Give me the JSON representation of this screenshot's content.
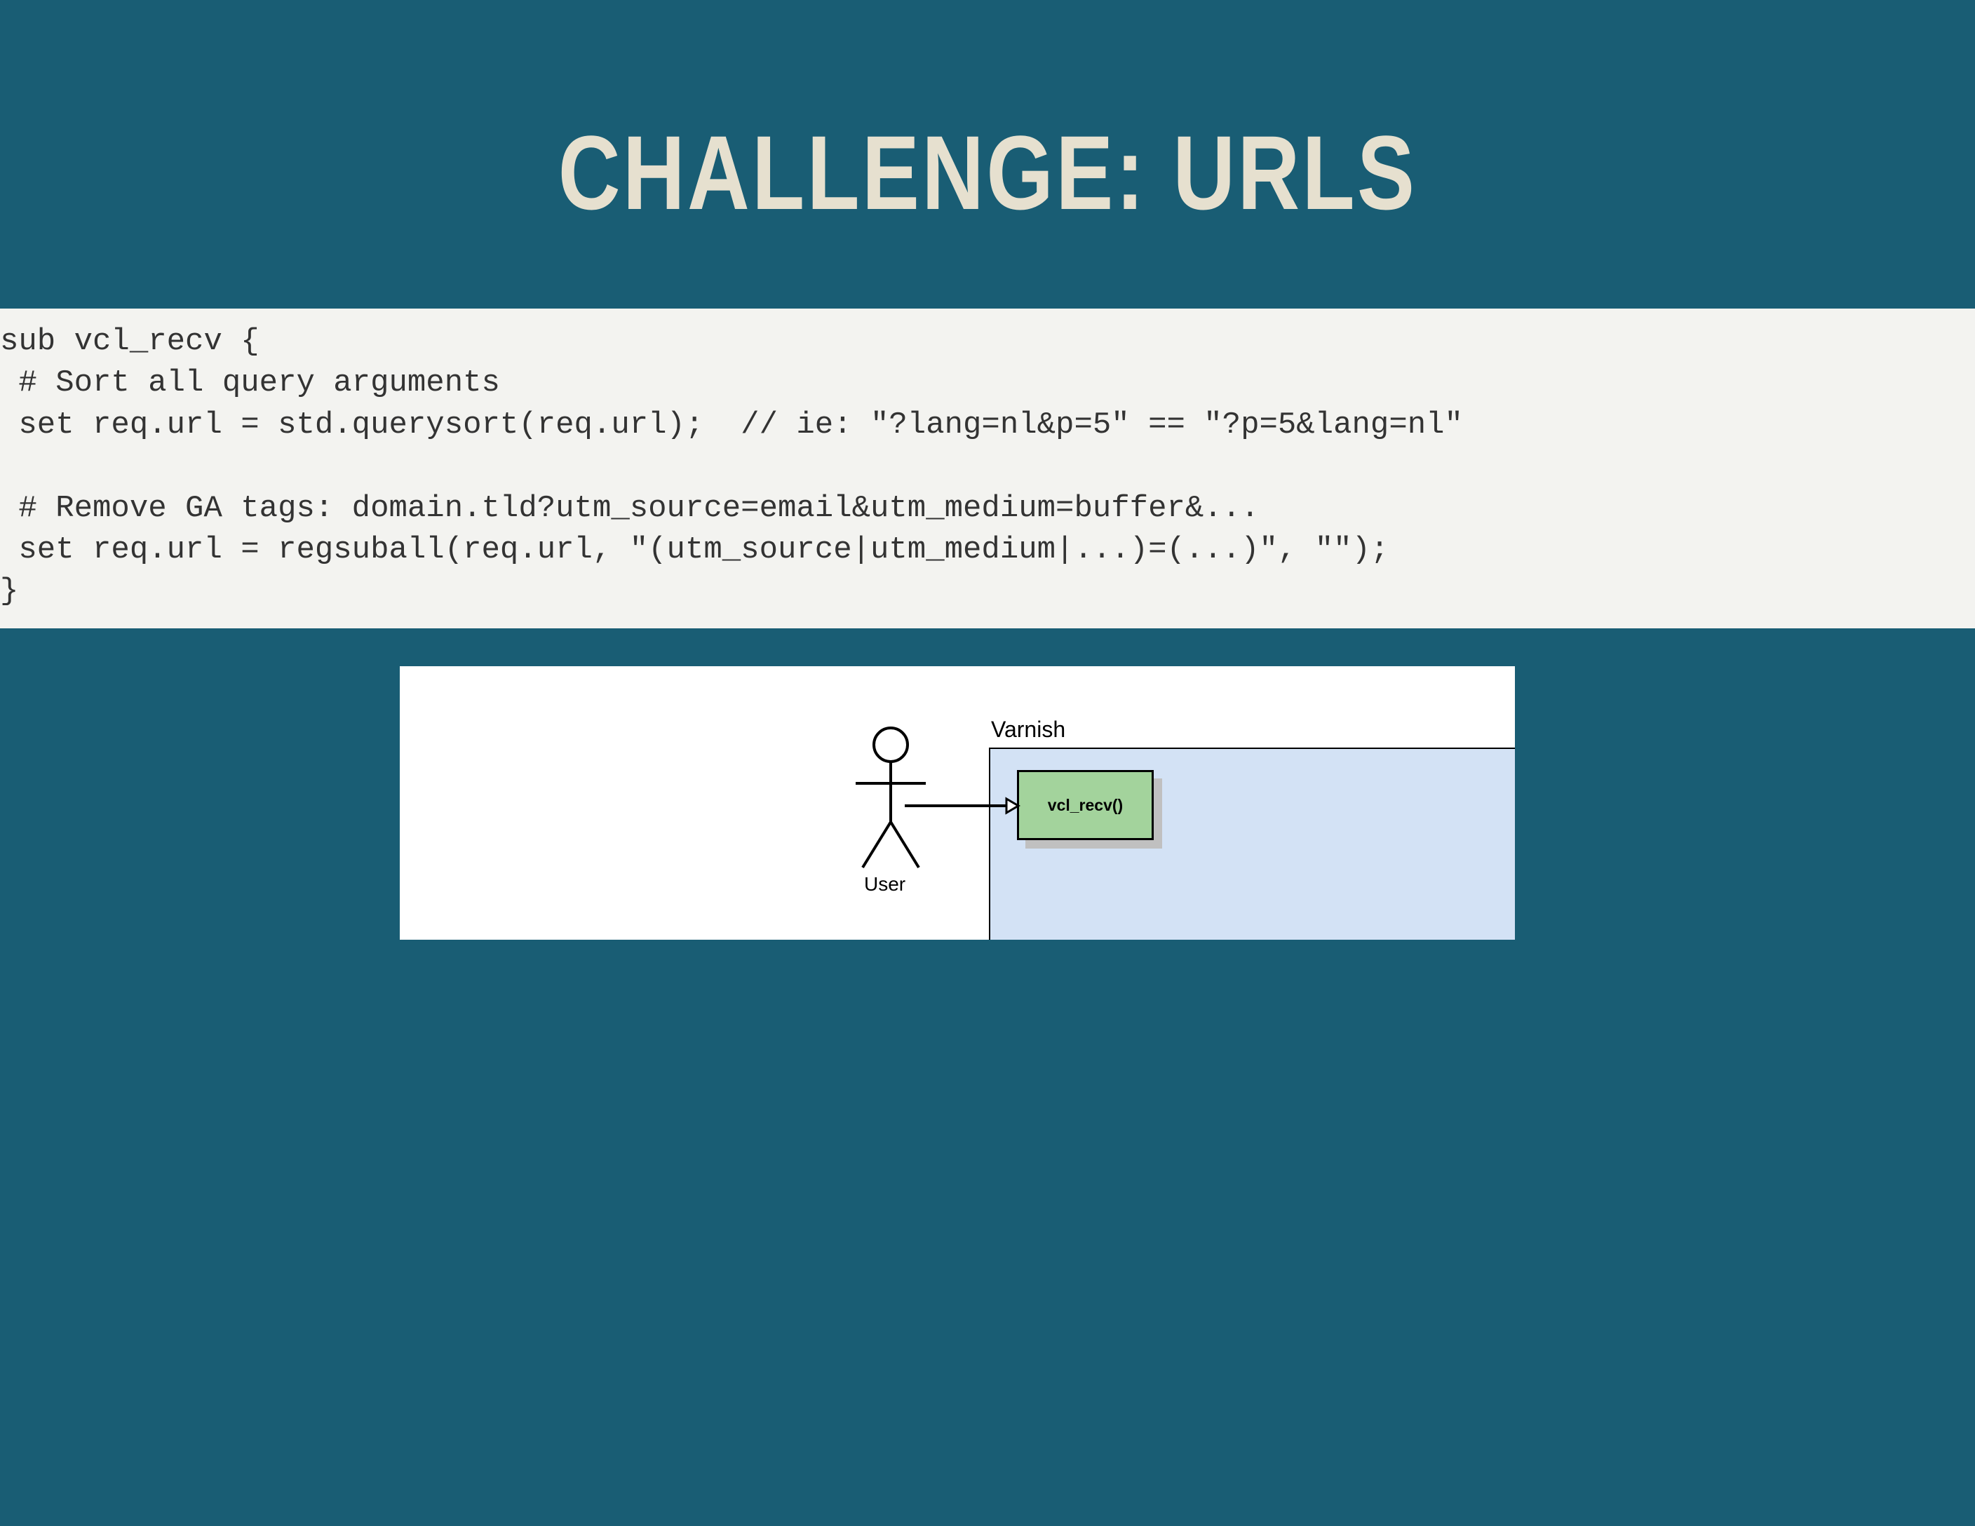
{
  "title": "CHALLENGE: URLS",
  "code": "sub vcl_recv {\n # Sort all query arguments\n set req.url = std.querysort(req.url);  // ie: \"?lang=nl&p=5\" == \"?p=5&lang=nl\"\n\n # Remove GA tags: domain.tld?utm_source=email&utm_medium=buffer&...\n set req.url = regsuball(req.url, \"(utm_source|utm_medium|...)=(...)\", \"\");\n}",
  "diagram": {
    "varnish_label": "Varnish",
    "user_label": "User",
    "recv_label": "vcl_recv()"
  }
}
